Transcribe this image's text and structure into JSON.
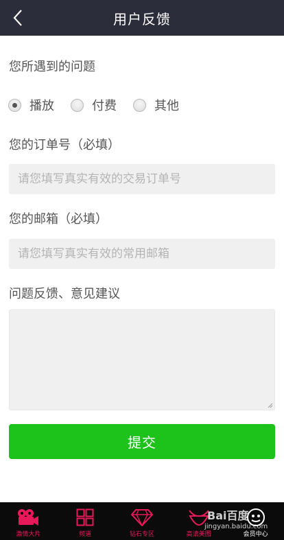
{
  "header": {
    "title": "用户反馈",
    "back_icon": "chevron-left-icon"
  },
  "problem": {
    "label": "您所遇到的问题",
    "options": [
      {
        "label": "播放",
        "selected": true
      },
      {
        "label": "付费",
        "selected": false
      },
      {
        "label": "其他",
        "selected": false
      }
    ]
  },
  "order": {
    "label": "您的订单号（必填）",
    "placeholder": "请您填写真实有效的交易订单号",
    "value": ""
  },
  "email": {
    "label": "您的邮箱（必填）",
    "placeholder": "请您填写真实有效的常用邮箱",
    "value": ""
  },
  "feedback": {
    "label": "问题反馈、意见建议",
    "value": ""
  },
  "submit": {
    "label": "提交",
    "color": "#1dc31b"
  },
  "tabbar": {
    "accent": "#e8195a",
    "items": [
      {
        "label": "激情大片",
        "icon": "film-camera-icon"
      },
      {
        "label": "频道",
        "icon": "grid-icon"
      },
      {
        "label": "钻石专区",
        "icon": "diamond-icon"
      },
      {
        "label": "高清美图",
        "icon": "bikini-icon"
      },
      {
        "label": "会员中心",
        "icon": "member-icon"
      }
    ]
  },
  "watermark": {
    "brand": "Bai百度",
    "url": "jingyan.baidu.com"
  }
}
